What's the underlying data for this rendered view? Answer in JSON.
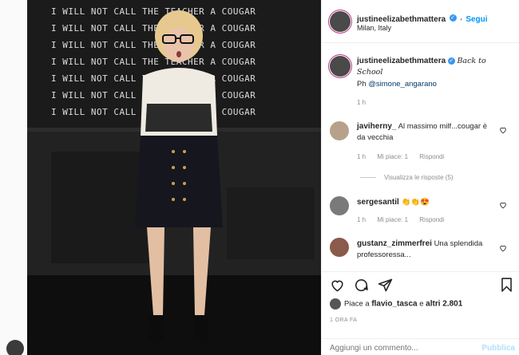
{
  "photo": {
    "board_lines": [
      "I WILL NOT CALL THE TEACHER A COUGAR",
      "I WILL NOT CALL THE TEACHER A COUGAR",
      "I WILL NOT CALL THE TEACHER A COUGAR",
      "I WILL NOT CALL THE TEACHER A COUGAR",
      "I WILL NOT CALL THE TEACHER A COUGAR",
      "I WILL NOT CALL THE TEACHER A COUGAR",
      "I WILL NOT CALL THE TEACHER A COUGAR"
    ]
  },
  "post_header": {
    "username": "justineelizabethmattera",
    "verified_glyph": "✓",
    "follow_separator": "•",
    "follow_label": "Segui",
    "location": "Milan, Italy"
  },
  "caption": {
    "username": "justineelizabethmattera",
    "text_script": "Back to School",
    "credit_prefix": "Ph ",
    "credit_mention": "@simone_angarano",
    "time": "1 h"
  },
  "comments": [
    {
      "username": "javiherny_",
      "text": "Al massimo milf...cougar è da vecchia",
      "time": "1 h",
      "likes": "Mi piace: 1",
      "reply": "Rispondi",
      "view_replies": "Visualizza le risposte (5)"
    },
    {
      "username": "sergesantil",
      "text": "👏👏😍",
      "time": "1 h",
      "likes": "Mi piace: 1",
      "reply": "Rispondi"
    },
    {
      "username": "gustanz_zimmerfrei",
      "text": "Una splendida professoressa...",
      "time": "",
      "likes": "",
      "reply": ""
    }
  ],
  "likes_line": {
    "prefix": "Piace a ",
    "user": "flavio_tasca",
    "middle": " e ",
    "others": "altri 2.801"
  },
  "timestamp": "1 ORA FA",
  "comment_box": {
    "placeholder": "Aggiungi un commento...",
    "publish_label": "Pubblica"
  },
  "colors": {
    "accent": "#0095f6",
    "verified": "#3897f0",
    "muted": "#8e8e8e"
  },
  "icons": [
    "heart-icon",
    "comment-icon",
    "share-icon",
    "bookmark-icon",
    "verified-icon"
  ]
}
